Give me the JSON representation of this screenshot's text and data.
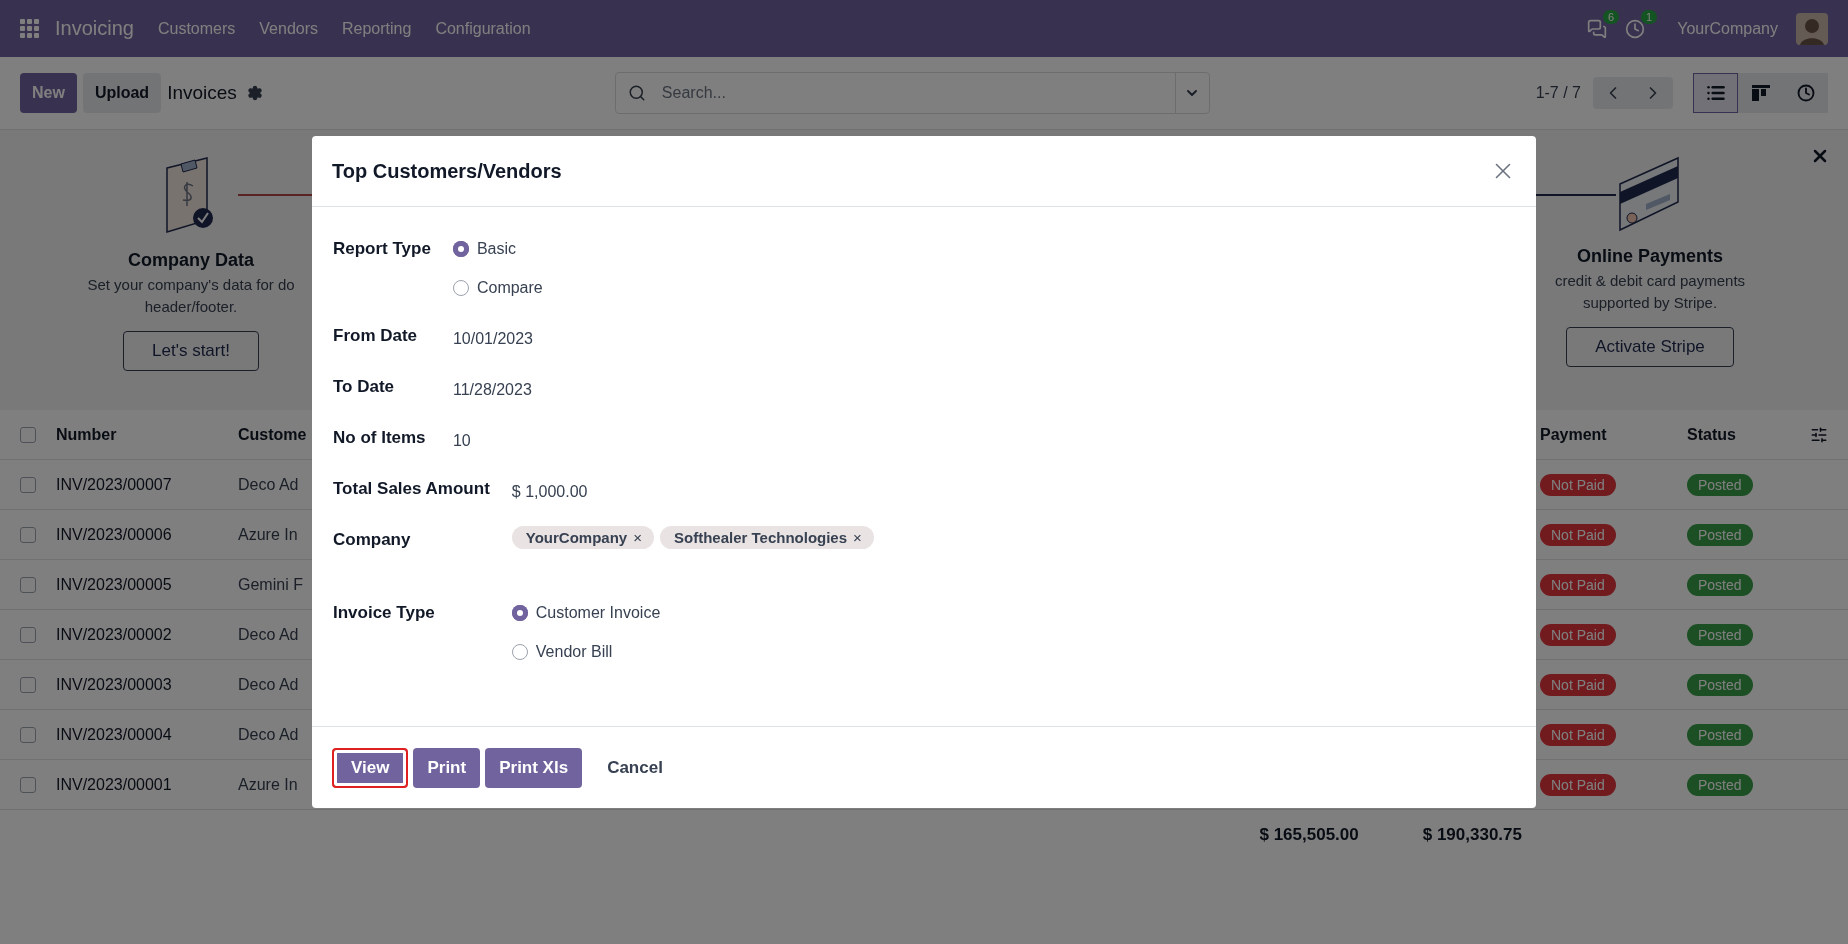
{
  "navbar": {
    "app_name": "Invoicing",
    "menu": [
      "Customers",
      "Vendors",
      "Reporting",
      "Configuration"
    ],
    "notifications": [
      {
        "kind": "messages",
        "count": "6"
      },
      {
        "kind": "activities",
        "count": "1"
      }
    ],
    "company": "YourCompany"
  },
  "control_panel": {
    "buttons": [
      {
        "label": "New",
        "kind": "primary"
      },
      {
        "label": "Upload",
        "kind": "secondary"
      }
    ],
    "title": "Invoices",
    "search": {
      "placeholder": "Search..."
    },
    "pager": "1-7 / 7",
    "views": [
      {
        "kind": "list",
        "selected": true
      },
      {
        "kind": "kanban",
        "selected": false
      },
      {
        "kind": "activity",
        "selected": false
      }
    ]
  },
  "onboarding": {
    "steps": [
      {
        "kind": "company",
        "title": "Company Data",
        "description_lines": [
          "Set your company's data for do",
          "header/footer."
        ],
        "button": "Let's start!"
      },
      {
        "kind": "payments",
        "title": "Online Payments",
        "description_lines": [
          "credit & debit card payments",
          "supported by Stripe."
        ],
        "button": "Activate Stripe"
      }
    ]
  },
  "table": {
    "all_checked": false,
    "columns": [
      "Number",
      "Custome",
      "Payment",
      "Status"
    ],
    "rows": [
      {
        "checked": false,
        "number": "INV/2023/00007",
        "customer": "Deco Ad",
        "payment": "Not Paid",
        "status": "Posted"
      },
      {
        "checked": false,
        "number": "INV/2023/00006",
        "customer": "Azure In",
        "payment": "Not Paid",
        "status": "Posted"
      },
      {
        "checked": false,
        "number": "INV/2023/00005",
        "customer": "Gemini F",
        "payment": "Not Paid",
        "status": "Posted"
      },
      {
        "checked": false,
        "number": "INV/2023/00002",
        "customer": "Deco Ad",
        "payment": "Not Paid",
        "status": "Posted"
      },
      {
        "checked": false,
        "number": "INV/2023/00003",
        "customer": "Deco Ad",
        "payment": "Not Paid",
        "status": "Posted"
      },
      {
        "checked": false,
        "number": "INV/2023/00004",
        "customer": "Deco Ad",
        "payment": "Not Paid",
        "status": "Posted"
      },
      {
        "checked": false,
        "number": "INV/2023/00001",
        "customer": "Azure In",
        "payment": "Not Paid",
        "status": "Posted"
      }
    ],
    "totals": [
      "$ 165,505.00",
      "$ 190,330.75"
    ]
  },
  "dialog": {
    "title": "Top Customers/Vendors",
    "sections": [
      {
        "fields": [
          {
            "kind": "radio",
            "label": "Report Type",
            "options": [
              {
                "label": "Basic",
                "selected": true
              },
              {
                "label": "Compare",
                "selected": false
              }
            ]
          },
          {
            "kind": "text",
            "label": "From Date",
            "value": "10/01/2023"
          },
          {
            "kind": "text",
            "label": "To Date",
            "value": "11/28/2023"
          },
          {
            "kind": "text",
            "label": "No of Items",
            "value": "10"
          }
        ]
      },
      {
        "fields": [
          {
            "kind": "text",
            "label": "Total Sales Amount",
            "value": "$ 1,000.00"
          },
          {
            "kind": "tags",
            "label": "Company",
            "tags": [
              {
                "label": "YourCompany",
                "remove": "×"
              },
              {
                "label": "Softhealer Technologies",
                "remove": "×"
              }
            ]
          },
          {
            "kind": "radio",
            "label": "Invoice Type",
            "options": [
              {
                "label": "Customer Invoice",
                "selected": true
              },
              {
                "label": "Vendor Bill",
                "selected": false
              }
            ]
          }
        ]
      }
    ],
    "buttons": [
      {
        "label": "View",
        "kind": "primary",
        "highlighted": true
      },
      {
        "label": "Print",
        "kind": "primary",
        "highlighted": false
      },
      {
        "label": "Print Xls",
        "kind": "primary",
        "highlighted": false
      },
      {
        "label": "Cancel",
        "kind": "link",
        "highlighted": false
      }
    ]
  }
}
